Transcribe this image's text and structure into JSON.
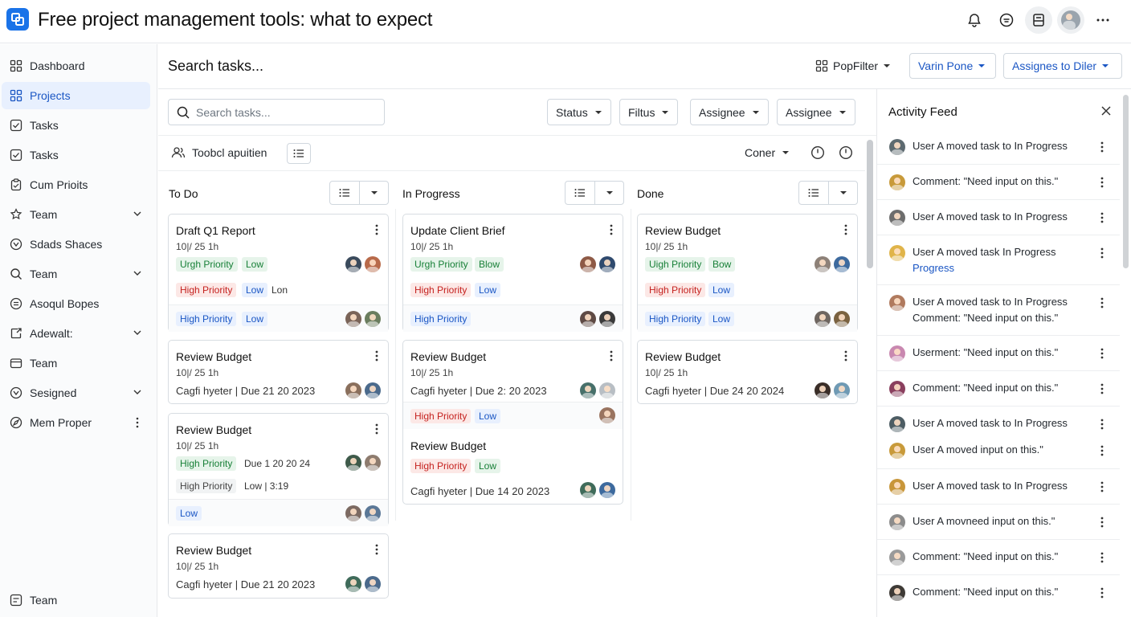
{
  "app": {
    "title": "Free project management tools: what to expect",
    "accent": "#1a73e8"
  },
  "sidebar": {
    "items": [
      {
        "label": "Dashboard",
        "icon": "dashboard-icon"
      },
      {
        "label": "Projects",
        "icon": "grid-icon"
      },
      {
        "label": "Tasks",
        "icon": "checkbox-icon"
      },
      {
        "label": "Tasks",
        "icon": "checkbox-icon"
      },
      {
        "label": "Cum Prioits",
        "icon": "clipboard-icon"
      },
      {
        "label": "Team",
        "icon": "team-icon"
      },
      {
        "label": "Sdads Shaces",
        "icon": "circle-check-icon"
      },
      {
        "label": "Team",
        "icon": "search-icon"
      },
      {
        "label": "Asoqul Bopes",
        "icon": "circle-lines-icon"
      },
      {
        "label": "Adewalt:",
        "icon": "export-icon"
      },
      {
        "label": "Team",
        "icon": "folder-icon"
      },
      {
        "label": "Sesigned",
        "icon": "circle-check-icon"
      },
      {
        "label": "Mem Proper",
        "icon": "compass-icon"
      }
    ],
    "footer": "Team"
  },
  "header": {
    "title": "Search tasks...",
    "pop_filter": "PopFilter",
    "btn1": "Varin Pone",
    "btn2": "Assignes to Diler"
  },
  "filters": {
    "search_placeholder": "Search tasks...",
    "status": "Status",
    "filtus": "Filtus",
    "assignee1": "Assignee",
    "assignee2": "Assignee"
  },
  "toolbar": {
    "label": "Toobcl apuitien",
    "coner": "Coner"
  },
  "columns": {
    "todo": "To Do",
    "inprogress": "In Progress",
    "done": "Done"
  },
  "cards": {
    "t1": {
      "title": "Draft Q1 Report",
      "date": "10|/ 25 1h",
      "tag1": "Urgh Priority",
      "tag2": "Low",
      "tag3": "High Priority",
      "tag4": "Low",
      "extra": "Lon",
      "ftag1": "High Priority",
      "ftag2": "Low"
    },
    "t2": {
      "title": "Review Budget",
      "date": "10|/ 25 1h",
      "meta": "Cagfi hyeter | Due 21 20 2023"
    },
    "t3": {
      "title": "Review Budget",
      "date": "10|/ 25 1h",
      "tag1": "High Priority",
      "due": "Due 1 20 20 24",
      "tag2": "High Priority",
      "low": "Low | 3:19",
      "ftag": "Low"
    },
    "t4": {
      "title": "Review Budget",
      "date": "10|/ 25 1h",
      "meta": "Cagfi hyeter | Due 21 20 2023"
    },
    "p1": {
      "title": "Update Client Brief",
      "date": "10|/ 25 1h",
      "tag1": "Urgh Priority",
      "tag2": "Blow",
      "tag3": "High Priority",
      "tag4": "Low",
      "ftag": "High Priority"
    },
    "p2": {
      "title": "Review Budget",
      "date": "10|/ 25 1h",
      "meta": "Cagfi hyeter | Due 2: 20 2023",
      "tag1": "High Priority",
      "tag2": "Low",
      "title2": "Review Budget",
      "tag3": "High Priority",
      "tag4": "Low",
      "meta2": "Cagfi hyeter | Due 14 20 2023"
    },
    "d1": {
      "title": "Review Budget",
      "date": "10|/ 25 1h",
      "tag1": "Uigh Priority",
      "tag2": "Bow",
      "tag3": "High Priority",
      "tag4": "Low",
      "ftag1": "High Priority",
      "ftag2": "Low"
    },
    "d2": {
      "title": "Review Budget",
      "date": "10|/ 25 1h",
      "meta": "Cagfi hyeter | Due 24 20 2024"
    }
  },
  "activity": {
    "title": "Activity Feed",
    "rows": [
      {
        "text": "User A moved task to In Progress"
      },
      {
        "text": "Comment: \"Need input on this.\""
      },
      {
        "text": "User A moved task to In Progress"
      },
      {
        "text": "User A moved task In Progress",
        "text2": "Progress"
      },
      {
        "text": "User A moved task to In Progress",
        "text2": "Comment: \"Need input on this.\""
      },
      {
        "text": "Userment: \"Need input on this.\""
      },
      {
        "text": "Comment: \"Need input on this.\""
      },
      {
        "text": "User A moved task to In Progress",
        "text2": "User A moved input on this.\""
      },
      {
        "text": "User A moved task to In Progress"
      },
      {
        "text": "User A movneed input on this.\""
      },
      {
        "text": "Comment: \"Need input on this.\""
      },
      {
        "text": "Comment: \"Need input on this.\""
      }
    ]
  }
}
